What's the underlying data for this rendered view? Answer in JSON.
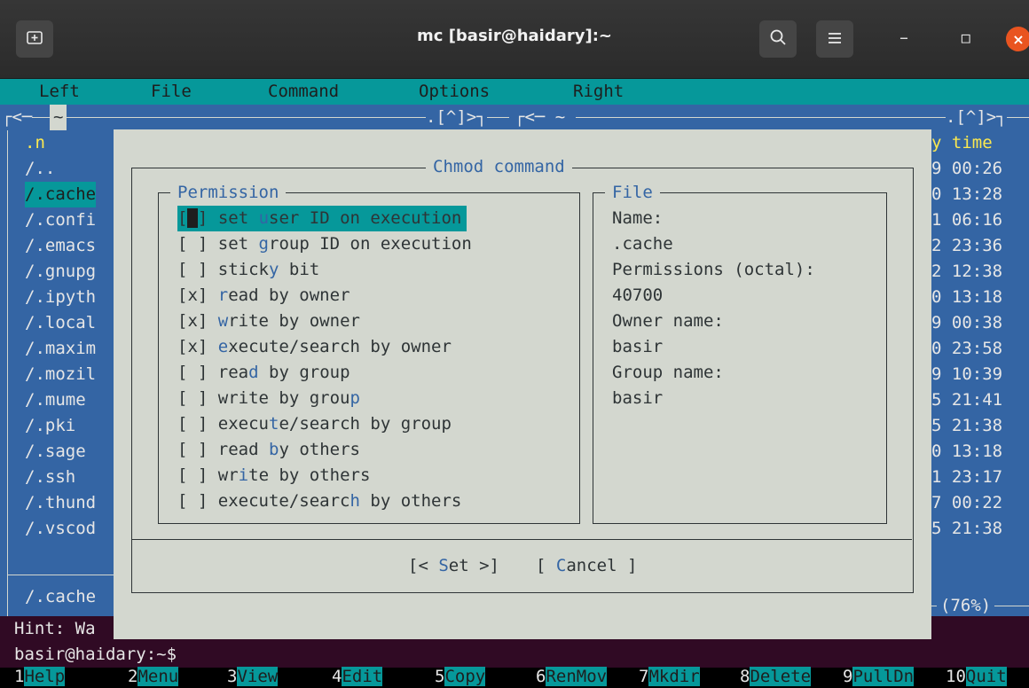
{
  "window": {
    "title": "mc [basir@haidary]:~",
    "new_tab_icon": "new-tab-icon",
    "search_icon": "search-icon",
    "menu_icon": "hamburger-menu-icon",
    "minimize": "–",
    "maximize": "▫",
    "close": "×"
  },
  "menubar": [
    "Left",
    "File",
    "Command",
    "Options",
    "Right"
  ],
  "left_panel": {
    "header": "<─ ~ ──────────────────────────── .[^]>",
    "path_tab": "~",
    "column_label": ".n",
    "files": [
      "/..",
      "/.cache",
      "/.confi",
      "/.emacs",
      "/.gnupg",
      "/.ipyth",
      "/.local",
      "/.maxim",
      "/.mozil",
      "/.mume",
      "/.pki",
      "/.sage",
      "/.ssh",
      "/.thund",
      "/.vscod"
    ],
    "selected_index": 1,
    "status": "/.cache"
  },
  "right_panel": {
    "header_left": "┌<─ ~ ",
    "header_right": ".[^]>┐",
    "column_label": "y time",
    "times": [
      "9 00:26",
      "0 13:28",
      "1 06:16",
      "2 23:36",
      "2 12:38",
      "0 13:18",
      "9 00:38",
      "0 23:58",
      "9 10:39",
      "5 21:41",
      "5 21:38",
      "0 13:18",
      "1 23:17",
      "7 00:22",
      "5 21:38"
    ],
    "usage": "(76%)"
  },
  "dialog": {
    "title": "Chmod command",
    "permission_title": "Permission",
    "file_title": "File",
    "permissions": [
      {
        "check": "[ ]",
        "pre": "set ",
        "hot": "u",
        "post": "ser ID on execution",
        "focused": true
      },
      {
        "check": "[ ]",
        "pre": "set ",
        "hot": "g",
        "post": "roup ID on execution",
        "focused": false
      },
      {
        "check": "[ ]",
        "pre": "stick",
        "hot": "y",
        "post": " bit",
        "focused": false
      },
      {
        "check": "[x]",
        "pre": "",
        "hot": "r",
        "post": "ead by owner",
        "focused": false
      },
      {
        "check": "[x]",
        "pre": "",
        "hot": "w",
        "post": "rite by owner",
        "focused": false
      },
      {
        "check": "[x]",
        "pre": "",
        "hot": "e",
        "post": "xecute/search by owner",
        "focused": false
      },
      {
        "check": "[ ]",
        "pre": "rea",
        "hot": "d",
        "post": " by group",
        "focused": false
      },
      {
        "check": "[ ]",
        "pre": "write by grou",
        "hot": "p",
        "post": "",
        "focused": false
      },
      {
        "check": "[ ]",
        "pre": "execu",
        "hot": "t",
        "post": "e/search by group",
        "focused": false
      },
      {
        "check": "[ ]",
        "pre": "read ",
        "hot": "b",
        "post": "y others",
        "focused": false
      },
      {
        "check": "[ ]",
        "pre": "wr",
        "hot": "i",
        "post": "te by others",
        "focused": false
      },
      {
        "check": "[ ]",
        "pre": "execute/searc",
        "hot": "h",
        "post": " by others",
        "focused": false
      }
    ],
    "file_info": {
      "name_label": "Name:",
      "name_value": ".cache",
      "perm_label": "Permissions (octal):",
      "perm_value": "40700",
      "owner_label": "Owner name:",
      "owner_value": "basir",
      "group_label": "Group name:",
      "group_value": "basir"
    },
    "set_button": {
      "pre": "[< ",
      "hot": "S",
      "post": "et >]"
    },
    "cancel_button": {
      "pre": "[ ",
      "hot": "C",
      "post": "ancel ]"
    }
  },
  "hint": "Hint: Wa",
  "prompt": "basir@haidary:~$",
  "fkeys": [
    {
      "num": "1",
      "label": "Help"
    },
    {
      "num": "2",
      "label": "Menu"
    },
    {
      "num": "3",
      "label": "View"
    },
    {
      "num": "4",
      "label": "Edit"
    },
    {
      "num": "5",
      "label": "Copy"
    },
    {
      "num": "6",
      "label": "RenMov"
    },
    {
      "num": "7",
      "label": "Mkdir"
    },
    {
      "num": "8",
      "label": "Delete"
    },
    {
      "num": "9",
      "label": "PullDn"
    },
    {
      "num": "10",
      "label": "Quit"
    }
  ],
  "colors": {
    "terminal_bg": "#300a24",
    "panel_bg": "#3465a4",
    "accent_cyan": "#06989a",
    "dialog_bg": "#d3d7cf",
    "hotkey_blue": "#3465a4",
    "close_orange": "#e95420"
  }
}
